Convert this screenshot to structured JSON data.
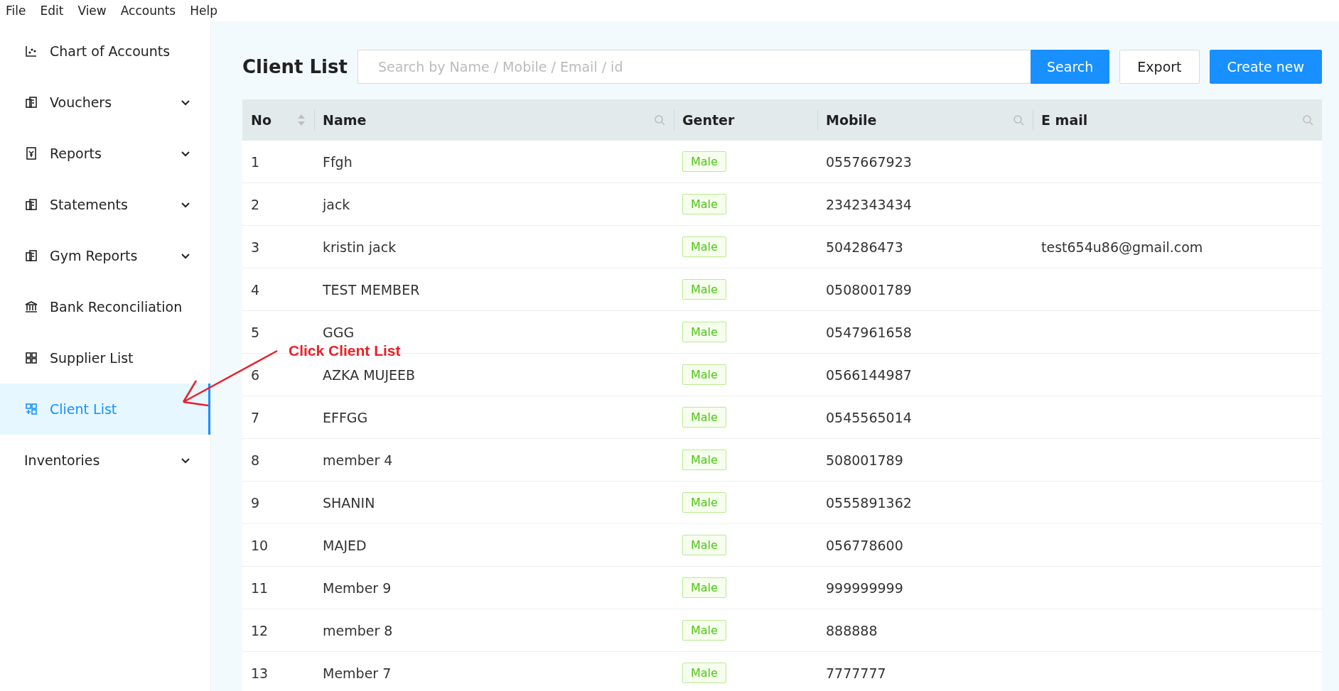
{
  "menu_bar": [
    "File",
    "Edit",
    "View",
    "Accounts",
    "Help"
  ],
  "sidebar": {
    "items": [
      {
        "label": "Chart of Accounts",
        "expandable": false,
        "selected": false
      },
      {
        "label": "Vouchers",
        "expandable": true,
        "selected": false
      },
      {
        "label": "Reports",
        "expandable": true,
        "selected": false
      },
      {
        "label": "Statements",
        "expandable": true,
        "selected": false
      },
      {
        "label": "Gym Reports",
        "expandable": true,
        "selected": false
      },
      {
        "label": "Bank Reconciliation",
        "expandable": false,
        "selected": false
      },
      {
        "label": "Supplier List",
        "expandable": false,
        "selected": false
      },
      {
        "label": "Client List",
        "expandable": false,
        "selected": true
      },
      {
        "label": "Inventories",
        "expandable": true,
        "selected": false
      }
    ]
  },
  "annotation": "Click Client List",
  "page_title": "Client List",
  "search": {
    "placeholder": "Search by Name / Mobile / Email / id",
    "button": "Search"
  },
  "buttons": [
    {
      "label": "Export",
      "primary": false
    },
    {
      "label": "Create new",
      "primary": true
    }
  ],
  "table": {
    "columns": [
      {
        "label": "No",
        "sortable": true,
        "filter": false
      },
      {
        "label": "Name",
        "sortable": false,
        "filter": true
      },
      {
        "label": "Genter",
        "sortable": false,
        "filter": false
      },
      {
        "label": "Mobile",
        "sortable": false,
        "filter": true
      },
      {
        "label": "E mail",
        "sortable": false,
        "filter": true
      }
    ],
    "rows": [
      {
        "no": "1",
        "name": "Ffgh",
        "gender": "Male",
        "mobile": "0557667923",
        "email": ""
      },
      {
        "no": "2",
        "name": "jack",
        "gender": "Male",
        "mobile": "2342343434",
        "email": ""
      },
      {
        "no": "3",
        "name": "kristin jack",
        "gender": "Male",
        "mobile": "504286473",
        "email": "test654u86@gmail.com"
      },
      {
        "no": "4",
        "name": "TEST MEMBER",
        "gender": "Male",
        "mobile": "0508001789",
        "email": ""
      },
      {
        "no": "5",
        "name": "GGG",
        "gender": "Male",
        "mobile": "0547961658",
        "email": ""
      },
      {
        "no": "6",
        "name": "AZKA MUJEEB",
        "gender": "Male",
        "mobile": "0566144987",
        "email": ""
      },
      {
        "no": "7",
        "name": "EFFGG",
        "gender": "Male",
        "mobile": "0545565014",
        "email": ""
      },
      {
        "no": "8",
        "name": "member 4",
        "gender": "Male",
        "mobile": "508001789",
        "email": ""
      },
      {
        "no": "9",
        "name": "SHANIN",
        "gender": "Male",
        "mobile": "0555891362",
        "email": ""
      },
      {
        "no": "10",
        "name": "MAJED",
        "gender": "Male",
        "mobile": "056778600",
        "email": ""
      },
      {
        "no": "11",
        "name": "Member 9",
        "gender": "Male",
        "mobile": "999999999",
        "email": ""
      },
      {
        "no": "12",
        "name": "member 8",
        "gender": "Male",
        "mobile": "888888",
        "email": ""
      },
      {
        "no": "13",
        "name": "Member 7",
        "gender": "Male",
        "mobile": "7777777",
        "email": ""
      }
    ]
  }
}
